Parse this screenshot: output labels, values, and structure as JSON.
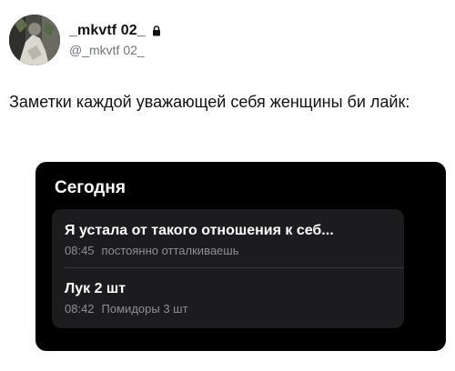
{
  "author": {
    "display_name": "_mkvtf 02_",
    "handle": "@_mkvtf 02_",
    "avatar_icon": "avatar-photo",
    "lock_icon": "lock-icon"
  },
  "tweet": {
    "text": "Заметки каждой уважающей себя женщины би лайк:"
  },
  "notes_screenshot": {
    "title": "Сегодня",
    "notes": [
      {
        "title": "Я устала от такого отношения к себ...",
        "time": "08:45",
        "preview": "постоянно отталкиваешь"
      },
      {
        "title": "Лук 2 шт",
        "time": "08:42",
        "preview": "Помидоры 3 шт"
      }
    ]
  },
  "colors": {
    "card_background": "#000000",
    "notes_panel": "#1c1c1e",
    "secondary_text": "#8e8e93"
  }
}
